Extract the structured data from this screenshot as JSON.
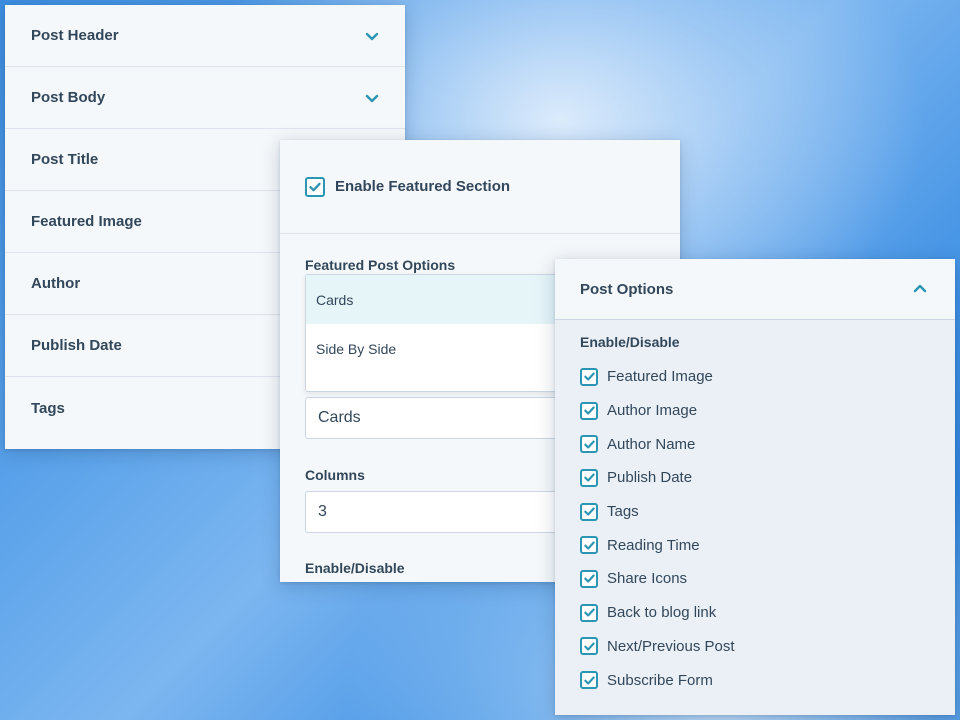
{
  "left_panel": {
    "items": [
      {
        "label": "Post Header",
        "chevron": "chevron-down-icon"
      },
      {
        "label": "Post Body",
        "chevron": "chevron-down-icon"
      },
      {
        "label": "Post Title"
      },
      {
        "label": "Featured Image"
      },
      {
        "label": "Author"
      },
      {
        "label": "Publish Date"
      },
      {
        "label": "Tags"
      }
    ]
  },
  "middle_panel": {
    "enable_label": "Enable Featured Section",
    "enable_checked": true,
    "featured_options_label": "Featured Post Options",
    "dropdown_options": [
      "Cards",
      "Side By Side"
    ],
    "dropdown_selected_index": 0,
    "select_value": "Cards",
    "columns_label": "Columns",
    "columns_value": "3",
    "enable_disable_label": "Enable/Disable"
  },
  "right_panel": {
    "title": "Post Options",
    "chevron": "chevron-up-icon",
    "sub_label": "Enable/Disable",
    "options": [
      {
        "label": "Featured Image",
        "checked": true
      },
      {
        "label": "Author Image",
        "checked": true
      },
      {
        "label": "Author Name",
        "checked": true
      },
      {
        "label": "Publish Date",
        "checked": true
      },
      {
        "label": "Tags",
        "checked": true
      },
      {
        "label": "Reading Time",
        "checked": true
      },
      {
        "label": "Share Icons",
        "checked": true
      },
      {
        "label": "Back to blog link",
        "checked": true
      },
      {
        "label": "Next/Previous Post",
        "checked": true
      },
      {
        "label": "Subscribe Form",
        "checked": true
      }
    ]
  },
  "colors": {
    "text": "#33475b",
    "checkbox": "#2a96b4",
    "panel_bg": "#f5f8fa",
    "selected_option": "#e5f5f8"
  }
}
